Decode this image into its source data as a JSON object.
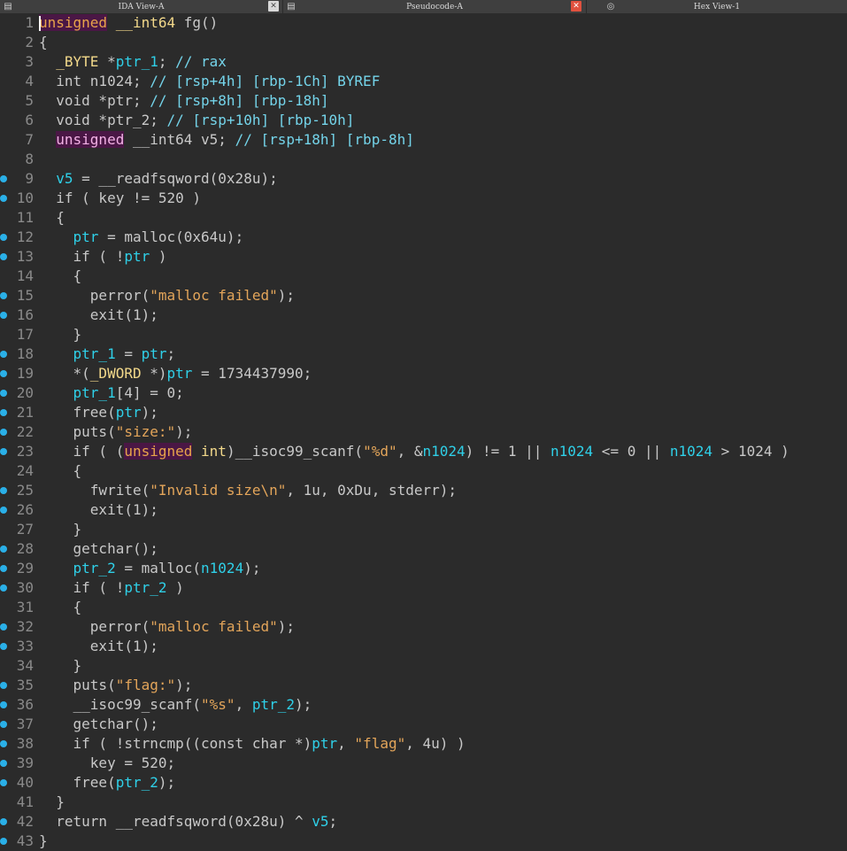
{
  "tabs": [
    {
      "label": "IDA View-A",
      "icon": "text-list-icon",
      "close": "gray"
    },
    {
      "label": "Pseudocode-A",
      "icon": "text-list-icon",
      "close": "red"
    },
    {
      "label": "Hex View-1",
      "icon": "hex-icon",
      "close": ""
    }
  ],
  "breakpoint_lines": [
    9,
    10,
    12,
    13,
    15,
    16,
    18,
    19,
    20,
    21,
    22,
    23,
    25,
    26,
    28,
    29,
    30,
    32,
    33,
    35,
    36,
    37,
    38,
    39,
    40,
    42,
    43
  ],
  "colors": {
    "background": "#2b2b2b",
    "string": "#e3a55a",
    "variable": "#2fd0e8",
    "breakpoint": "#2ab0e8",
    "line_number": "#8a8a8a"
  },
  "code_lines": [
    [
      [
        "uns",
        "unsigned"
      ],
      [
        "def",
        " "
      ],
      [
        "ty",
        "__int64"
      ],
      [
        "def",
        " fg()"
      ]
    ],
    [
      [
        "def",
        "{"
      ]
    ],
    [
      [
        "def",
        "  "
      ],
      [
        "ty",
        "_BYTE"
      ],
      [
        "def",
        " *"
      ],
      [
        "var",
        "ptr_1"
      ],
      [
        "def",
        "; "
      ],
      [
        "cmt",
        "// rax"
      ]
    ],
    [
      [
        "def",
        "  int n1024; "
      ],
      [
        "cmt",
        "// [rsp+4h] [rbp-1Ch] BYREF"
      ]
    ],
    [
      [
        "def",
        "  void *ptr; "
      ],
      [
        "cmt",
        "// [rsp+8h] [rbp-18h]"
      ]
    ],
    [
      [
        "def",
        "  void *ptr_2; "
      ],
      [
        "cmt",
        "// [rsp+10h] [rbp-10h]"
      ]
    ],
    [
      [
        "def",
        "  "
      ],
      [
        "uns2",
        "unsigned"
      ],
      [
        "def",
        " __int64 v5; "
      ],
      [
        "cmt",
        "// [rsp+18h] [rbp-8h]"
      ]
    ],
    [
      [
        "def",
        ""
      ]
    ],
    [
      [
        "def",
        "  "
      ],
      [
        "var",
        "v5"
      ],
      [
        "def",
        " = __readfsqword(0x28u);"
      ]
    ],
    [
      [
        "def",
        "  if ( key != 520 )"
      ]
    ],
    [
      [
        "def",
        "  {"
      ]
    ],
    [
      [
        "def",
        "    "
      ],
      [
        "var",
        "ptr"
      ],
      [
        "def",
        " = malloc(0x64u);"
      ]
    ],
    [
      [
        "def",
        "    if ( !"
      ],
      [
        "var",
        "ptr"
      ],
      [
        "def",
        " )"
      ]
    ],
    [
      [
        "def",
        "    {"
      ]
    ],
    [
      [
        "def",
        "      perror("
      ],
      [
        "str",
        "\"malloc failed\""
      ],
      [
        "def",
        ");"
      ]
    ],
    [
      [
        "def",
        "      exit(1);"
      ]
    ],
    [
      [
        "def",
        "    }"
      ]
    ],
    [
      [
        "def",
        "    "
      ],
      [
        "var",
        "ptr_1"
      ],
      [
        "def",
        " = "
      ],
      [
        "var",
        "ptr"
      ],
      [
        "def",
        ";"
      ]
    ],
    [
      [
        "def",
        "    *("
      ],
      [
        "ty",
        "_DWORD"
      ],
      [
        "def",
        " *)"
      ],
      [
        "var",
        "ptr"
      ],
      [
        "def",
        " = 1734437990;"
      ]
    ],
    [
      [
        "def",
        "    "
      ],
      [
        "var",
        "ptr_1"
      ],
      [
        "def",
        "[4] = 0;"
      ]
    ],
    [
      [
        "def",
        "    free("
      ],
      [
        "var",
        "ptr"
      ],
      [
        "def",
        ");"
      ]
    ],
    [
      [
        "def",
        "    puts("
      ],
      [
        "str",
        "\"size:\""
      ],
      [
        "def",
        ");"
      ]
    ],
    [
      [
        "def",
        "    if ( ("
      ],
      [
        "uns",
        "unsigned"
      ],
      [
        "def",
        " "
      ],
      [
        "ty",
        "int"
      ],
      [
        "def",
        ")__isoc99_scanf("
      ],
      [
        "str",
        "\"%d\""
      ],
      [
        "def",
        ", &"
      ],
      [
        "var",
        "n1024"
      ],
      [
        "def",
        ") != 1 || "
      ],
      [
        "var",
        "n1024"
      ],
      [
        "def",
        " <= 0 || "
      ],
      [
        "var",
        "n1024"
      ],
      [
        "def",
        " > 1024 )"
      ]
    ],
    [
      [
        "def",
        "    {"
      ]
    ],
    [
      [
        "def",
        "      fwrite("
      ],
      [
        "str",
        "\"Invalid size\\n\""
      ],
      [
        "def",
        ", 1u, 0xDu, stderr);"
      ]
    ],
    [
      [
        "def",
        "      exit(1);"
      ]
    ],
    [
      [
        "def",
        "    }"
      ]
    ],
    [
      [
        "def",
        "    getchar();"
      ]
    ],
    [
      [
        "def",
        "    "
      ],
      [
        "var",
        "ptr_2"
      ],
      [
        "def",
        " = malloc("
      ],
      [
        "var",
        "n1024"
      ],
      [
        "def",
        ");"
      ]
    ],
    [
      [
        "def",
        "    if ( !"
      ],
      [
        "var",
        "ptr_2"
      ],
      [
        "def",
        " )"
      ]
    ],
    [
      [
        "def",
        "    {"
      ]
    ],
    [
      [
        "def",
        "      perror("
      ],
      [
        "str",
        "\"malloc failed\""
      ],
      [
        "def",
        ");"
      ]
    ],
    [
      [
        "def",
        "      exit(1);"
      ]
    ],
    [
      [
        "def",
        "    }"
      ]
    ],
    [
      [
        "def",
        "    puts("
      ],
      [
        "str",
        "\"flag:\""
      ],
      [
        "def",
        ");"
      ]
    ],
    [
      [
        "def",
        "    __isoc99_scanf("
      ],
      [
        "str",
        "\"%s\""
      ],
      [
        "def",
        ", "
      ],
      [
        "var",
        "ptr_2"
      ],
      [
        "def",
        ");"
      ]
    ],
    [
      [
        "def",
        "    getchar();"
      ]
    ],
    [
      [
        "def",
        "    if ( !strncmp((const char *)"
      ],
      [
        "var",
        "ptr"
      ],
      [
        "def",
        ", "
      ],
      [
        "str",
        "\"flag\""
      ],
      [
        "def",
        ", 4u) )"
      ]
    ],
    [
      [
        "def",
        "      key = 520;"
      ]
    ],
    [
      [
        "def",
        "    free("
      ],
      [
        "var",
        "ptr_2"
      ],
      [
        "def",
        ");"
      ]
    ],
    [
      [
        "def",
        "  }"
      ]
    ],
    [
      [
        "def",
        "  return __readfsqword(0x28u) ^ "
      ],
      [
        "var",
        "v5"
      ],
      [
        "def",
        ";"
      ]
    ],
    [
      [
        "def",
        "}"
      ]
    ]
  ]
}
